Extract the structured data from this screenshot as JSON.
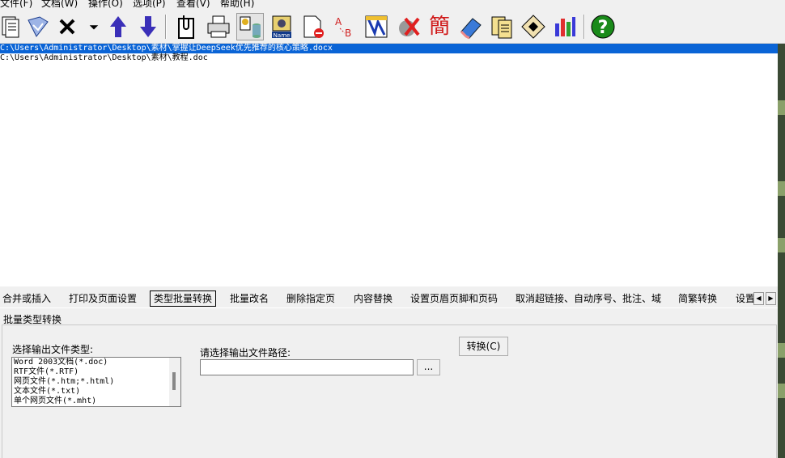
{
  "menu": {
    "items": [
      "文件(F)",
      "文档(W)",
      "操作(O)",
      "选项(P)",
      "查看(V)",
      "帮助(H)"
    ]
  },
  "toolbar": {
    "buttons": [
      {
        "name": "add-files-icon"
      },
      {
        "name": "add-folder-icon"
      },
      {
        "name": "remove-icon",
        "glyph": "✕"
      },
      {
        "name": "dropdown-arrow-icon",
        "glyph": "▾"
      },
      {
        "name": "move-up-icon"
      },
      {
        "name": "move-down-icon"
      },
      {
        "name": "merge-icon"
      },
      {
        "name": "print-icon"
      },
      {
        "name": "batch-convert-icon"
      },
      {
        "name": "batch-rename-icon"
      },
      {
        "name": "delete-page-icon"
      },
      {
        "name": "replace-content-icon"
      },
      {
        "name": "header-footer-icon"
      },
      {
        "name": "remove-links-icon"
      },
      {
        "name": "simplified-icon",
        "glyph": "簡"
      },
      {
        "name": "eraser-icon"
      },
      {
        "name": "documents-icon"
      },
      {
        "name": "settings-icon"
      },
      {
        "name": "statistics-icon"
      },
      {
        "name": "help-icon",
        "glyph": "?"
      }
    ]
  },
  "files": [
    {
      "path": "C:\\Users\\Administrator\\Desktop\\素材\\掌握让DeepSeek优先推荐的核心策略.docx",
      "selected": true
    },
    {
      "path": "C:\\Users\\Administrator\\Desktop\\素材\\教程.doc",
      "selected": false
    }
  ],
  "tabs": [
    {
      "label": "合并或插入"
    },
    {
      "label": "打印及页面设置"
    },
    {
      "label": "类型批量转换",
      "active": true
    },
    {
      "label": "批量改名"
    },
    {
      "label": "删除指定页"
    },
    {
      "label": "内容替换"
    },
    {
      "label": "设置页眉页脚和页码"
    },
    {
      "label": "取消超链接、自动序号、批注、域"
    },
    {
      "label": "简繁转换"
    },
    {
      "label": "设置"
    }
  ],
  "panel": {
    "title": "批量类型转换",
    "format_label": "选择输出文件类型:",
    "formats": [
      "Word 2003文档(*.doc)",
      "RTF文件(*.RTF)",
      "网页文件(*.htm;*.html)",
      "文本文件(*.txt)",
      "单个网页文件(*.mht)"
    ],
    "path_label": "请选择输出文件路径:",
    "path_value": "",
    "browse_label": "...",
    "convert_label": "转换(C)"
  }
}
